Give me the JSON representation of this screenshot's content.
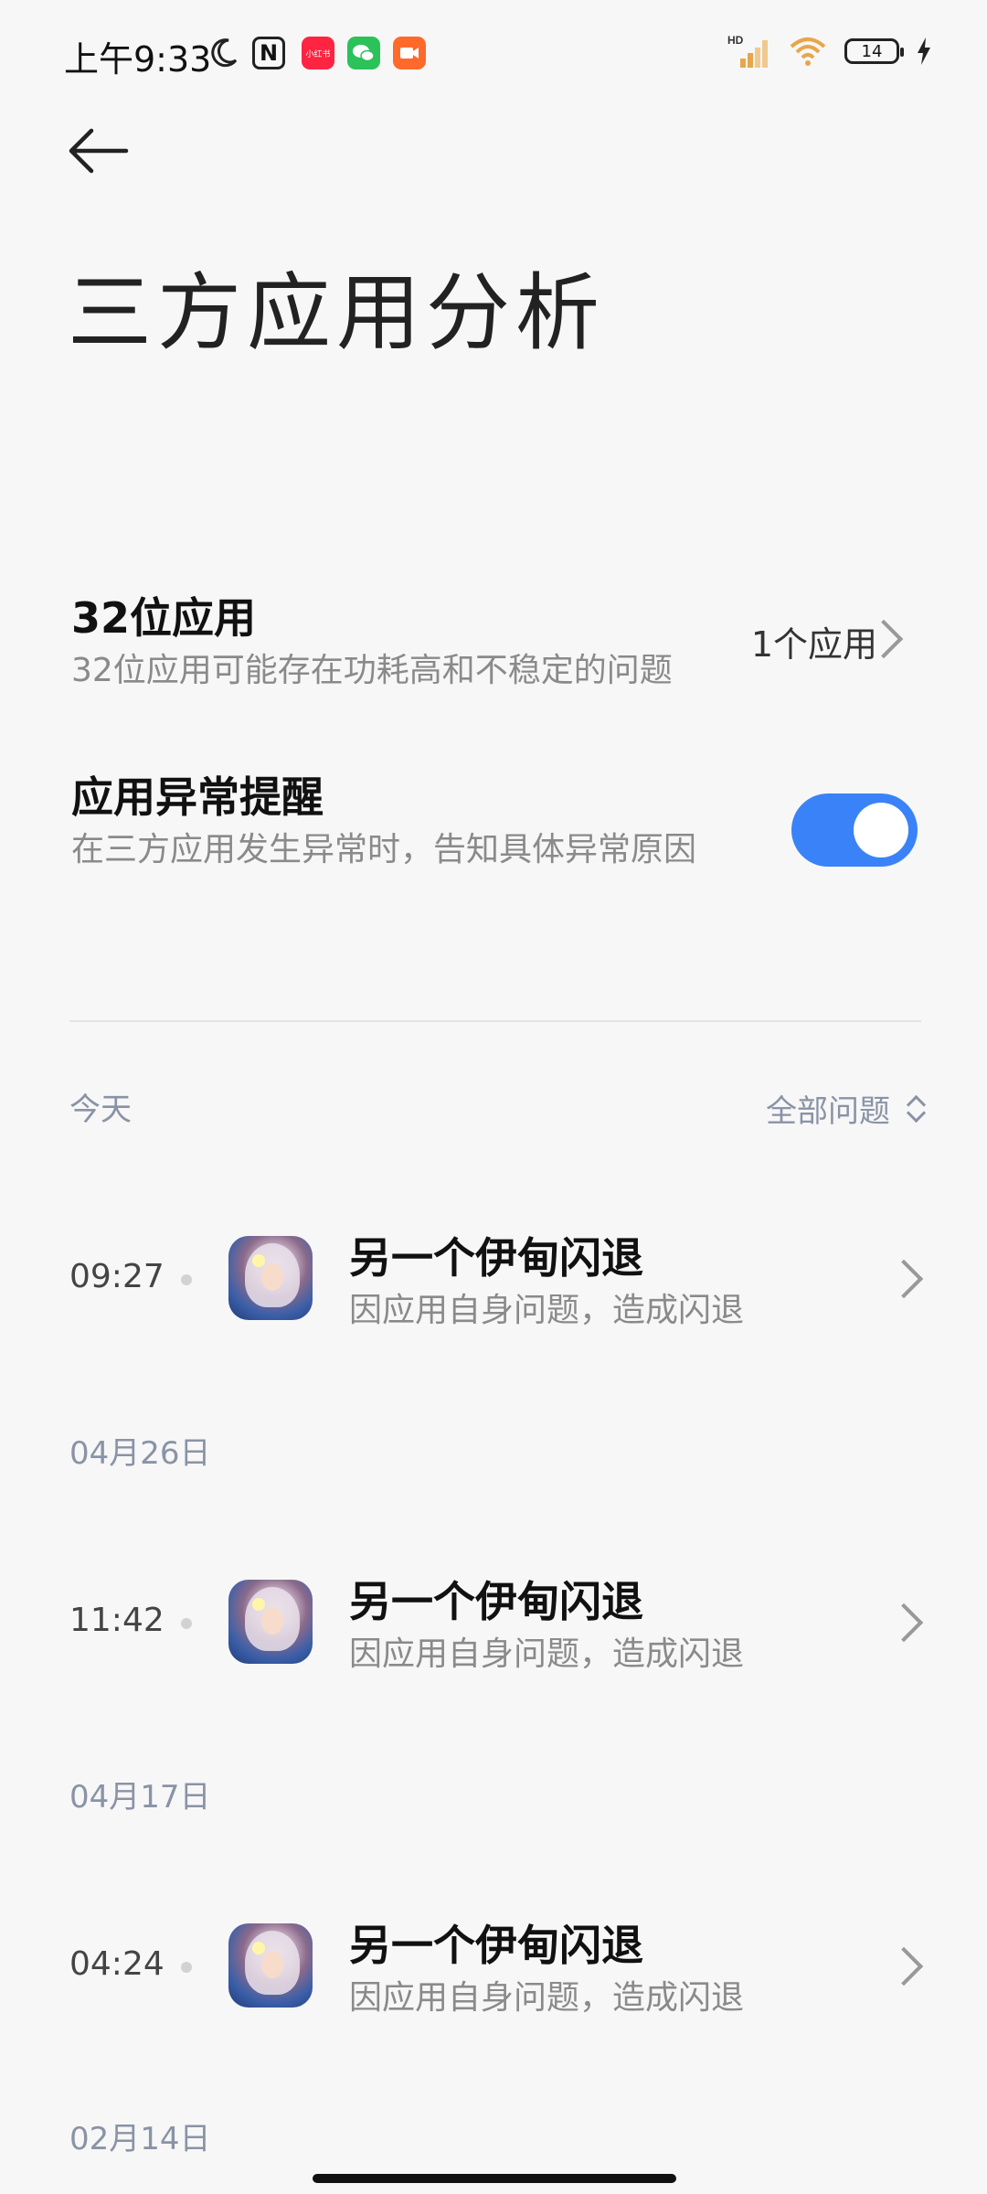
{
  "status_bar": {
    "time": "上午9:33",
    "icons": [
      "moon-icon",
      "nfc-icon",
      "xiaohongshu-icon",
      "wechat-icon",
      "video-icon"
    ],
    "xhs_label": "小红书",
    "network": "HD",
    "battery": "14"
  },
  "header": {
    "title": "三方应用分析"
  },
  "settings": {
    "app32": {
      "title": "32位应用",
      "subtitle": "32位应用可能存在功耗高和不稳定的问题",
      "value": "1个应用"
    },
    "alert": {
      "title": "应用异常提醒",
      "subtitle": "在三方应用发生异常时，告知具体异常原因",
      "enabled": true
    }
  },
  "list": {
    "filter_label": "全部问题",
    "groups": [
      {
        "date": "今天",
        "item": {
          "time": "09:27",
          "title": "另一个伊甸闪退",
          "subtitle": "因应用自身问题，造成闪退"
        }
      },
      {
        "date": "04月26日",
        "item": {
          "time": "11:42",
          "title": "另一个伊甸闪退",
          "subtitle": "因应用自身问题，造成闪退"
        }
      },
      {
        "date": "04月17日",
        "item": {
          "time": "04:24",
          "title": "另一个伊甸闪退",
          "subtitle": "因应用自身问题，造成闪退"
        }
      },
      {
        "date": "02月14日"
      }
    ]
  },
  "colors": {
    "accent": "#3a82f7",
    "secondary_text": "#8a8a8a",
    "section_label": "#8a93a6"
  }
}
